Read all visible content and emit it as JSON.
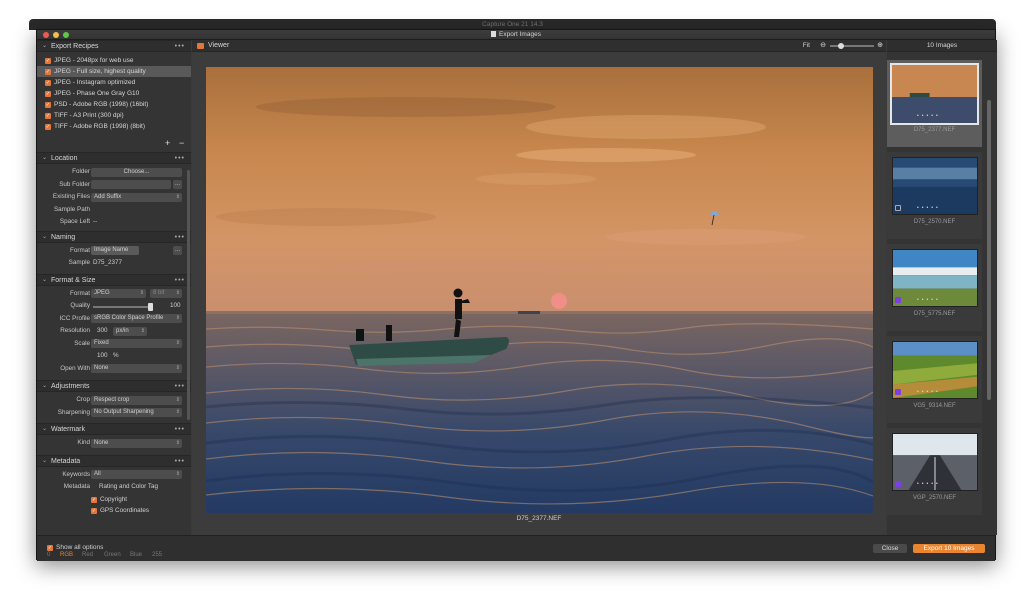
{
  "background_app": {
    "title": "Capture One 21 14.3"
  },
  "window": {
    "title": "Export Images"
  },
  "left_panel": {
    "recipes": {
      "header": "Export Recipes",
      "items": [
        {
          "label": "JPEG - 2048px for web use",
          "checked": true,
          "selected": false
        },
        {
          "label": "JPEG - Full size, highest quality",
          "checked": true,
          "selected": true
        },
        {
          "label": "JPEG - Instagram optimized",
          "checked": true,
          "selected": false
        },
        {
          "label": "JPEG - Phase One Gray G10",
          "checked": true,
          "selected": false
        },
        {
          "label": "PSD - Adobe RGB (1998) (16bit)",
          "checked": true,
          "selected": false
        },
        {
          "label": "TIFF - A3 Print (300 dpi)",
          "checked": true,
          "selected": false
        },
        {
          "label": "TIFF - Adobe RGB (1998) (8bit)",
          "checked": true,
          "selected": false
        }
      ],
      "add": "+",
      "remove": "−"
    },
    "location": {
      "header": "Location",
      "folder_label": "Folder",
      "folder_button": "Choose...",
      "subfolder_label": "Sub Folder",
      "subfolder_btn": "...",
      "existing_label": "Existing Files",
      "existing_value": "Add Suffix",
      "sample_path_label": "Sample Path",
      "space_left_label": "Space Left",
      "space_left_value": "--"
    },
    "naming": {
      "header": "Naming",
      "format_label": "Format",
      "format_value": "Image Name",
      "format_btn": "...",
      "sample_label": "Sample",
      "sample_value": "D75_2377"
    },
    "format_size": {
      "header": "Format & Size",
      "format_label": "Format",
      "format_value": "JPEG",
      "bit_value": "8 bit",
      "quality_label": "Quality",
      "quality_value": "100",
      "quality_fraction": 1.0,
      "icc_label": "ICC Profile",
      "icc_value": "sRGB Color Space Profile",
      "resolution_label": "Resolution",
      "resolution_value": "300",
      "resolution_unit": "px/in",
      "scale_label": "Scale",
      "scale_value": "Fixed",
      "scale_percent": "100",
      "percent_sign": "%",
      "open_with_label": "Open With",
      "open_with_value": "None"
    },
    "adjustments": {
      "header": "Adjustments",
      "crop_label": "Crop",
      "crop_value": "Respect crop",
      "sharpening_label": "Sharpening",
      "sharpening_value": "No Output Sharpening"
    },
    "watermark": {
      "header": "Watermark",
      "kind_label": "Kind",
      "kind_value": "None"
    },
    "metadata": {
      "header": "Metadata",
      "keywords_label": "Keywords",
      "keywords_value": "All",
      "metadata_label": "Metadata",
      "rating_label": "Rating and Color Tag",
      "copyright_label": "Copyright",
      "gps_label": "GPS Coordinates"
    }
  },
  "viewer": {
    "title": "Viewer",
    "fit_label": "Fit",
    "caption": "D75_2377.NEF"
  },
  "browser": {
    "header": "10 Images",
    "thumbs": [
      {
        "name": "D75_2377.NEF",
        "selected": true,
        "tag_color": ""
      },
      {
        "name": "D75_2570.NEF",
        "selected": false,
        "tag_color": ""
      },
      {
        "name": "D75_5775.NEF",
        "selected": false,
        "tag_color": "#7b3fe4"
      },
      {
        "name": "VG5_9314.NEF",
        "selected": false,
        "tag_color": "#7b3fe4"
      },
      {
        "name": "VGP_2570.NEF",
        "selected": false,
        "tag_color": "#7b3fe4"
      }
    ]
  },
  "footer": {
    "show_all_label": "Show all options",
    "close_label": "Close",
    "export_label": "Export 10 Images"
  },
  "bottom_strip": {
    "zero": "0",
    "rgb": "RGB",
    "red": "Red",
    "green": "Green",
    "blue": "Blue",
    "value": "255"
  },
  "colors": {
    "accent": "#e9842f",
    "checkbox": "#e3763a",
    "panel": "#343434",
    "purple_tag": "#7b3fe4"
  }
}
